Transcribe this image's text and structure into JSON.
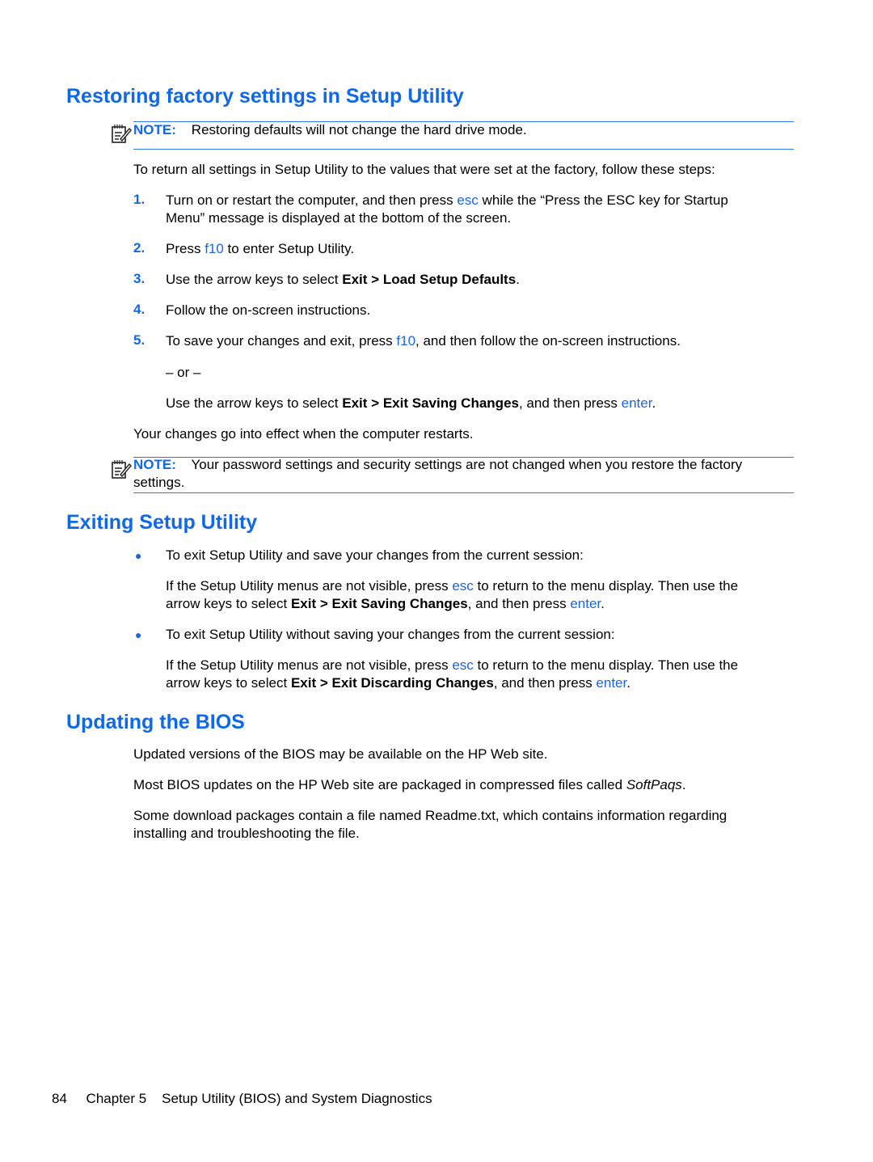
{
  "sections": {
    "restoring": {
      "title": "Restoring factory settings in Setup Utility",
      "note1": {
        "label": "NOTE:",
        "text": "Restoring defaults will not change the hard drive mode."
      },
      "intro": "To return all settings in Setup Utility to the values that were set at the factory, follow these steps:",
      "steps": [
        {
          "num": "1.",
          "t1": "Turn on or restart the computer, and then press ",
          "key": "esc",
          "t2": " while the “Press the ESC key for Startup",
          "line2": "Menu” message is displayed at the bottom of the screen."
        },
        {
          "num": "2.",
          "t1": "Press ",
          "key": "f10",
          "t2": " to enter Setup Utility."
        },
        {
          "num": "3.",
          "t1": "Use the arrow keys to select ",
          "bold": "Exit > Load Setup Defaults",
          "t2": "."
        },
        {
          "num": "4.",
          "t1": "Follow the on-screen instructions."
        },
        {
          "num": "5.",
          "t1": "To save your changes and exit, press ",
          "key": "f10",
          "t2": ", and then follow the on-screen instructions."
        }
      ],
      "or_text": "– or –",
      "alt": {
        "t1": "Use the arrow keys to select ",
        "bold": "Exit > Exit Saving Changes",
        "t2": ", and then press ",
        "key": "enter",
        "t3": "."
      },
      "outro": "Your changes go into effect when the computer restarts.",
      "note2": {
        "label": "NOTE:",
        "text": "Your password settings and security settings are not changed when you restore the factory",
        "line2": "settings."
      }
    },
    "exiting": {
      "title": "Exiting Setup Utility",
      "items": [
        {
          "bullet": "●",
          "text": "To exit Setup Utility and save your changes from the current session:",
          "d1": "If the Setup Utility menus are not visible, press ",
          "key1": "esc",
          "d2": " to return to the menu display. Then use the",
          "d3": "arrow keys to select ",
          "bold": "Exit > Exit Saving Changes",
          "d4": ", and then press ",
          "key2": "enter",
          "d5": "."
        },
        {
          "bullet": "●",
          "text": "To exit Setup Utility without saving your changes from the current session:",
          "d1": "If the Setup Utility menus are not visible, press ",
          "key1": "esc",
          "d2": " to return to the menu display. Then use the",
          "d3": "arrow keys to select ",
          "bold": "Exit > Exit Discarding Changes",
          "d4": ", and then press ",
          "key2": "enter",
          "d5": "."
        }
      ]
    },
    "updating": {
      "title": "Updating the BIOS",
      "p1": "Updated versions of the BIOS may be available on the HP Web site.",
      "p2a": "Most BIOS updates on the HP Web site are packaged in compressed files called ",
      "p2i": "SoftPaqs",
      "p2b": ".",
      "p3a": "Some download packages contain a file named Readme.txt, which contains information regarding",
      "p3b": "installing and troubleshooting the file."
    }
  },
  "footer": {
    "page": "84",
    "chapter": "Chapter 5",
    "chapter_title": "Setup Utility (BIOS) and System Diagnostics"
  }
}
